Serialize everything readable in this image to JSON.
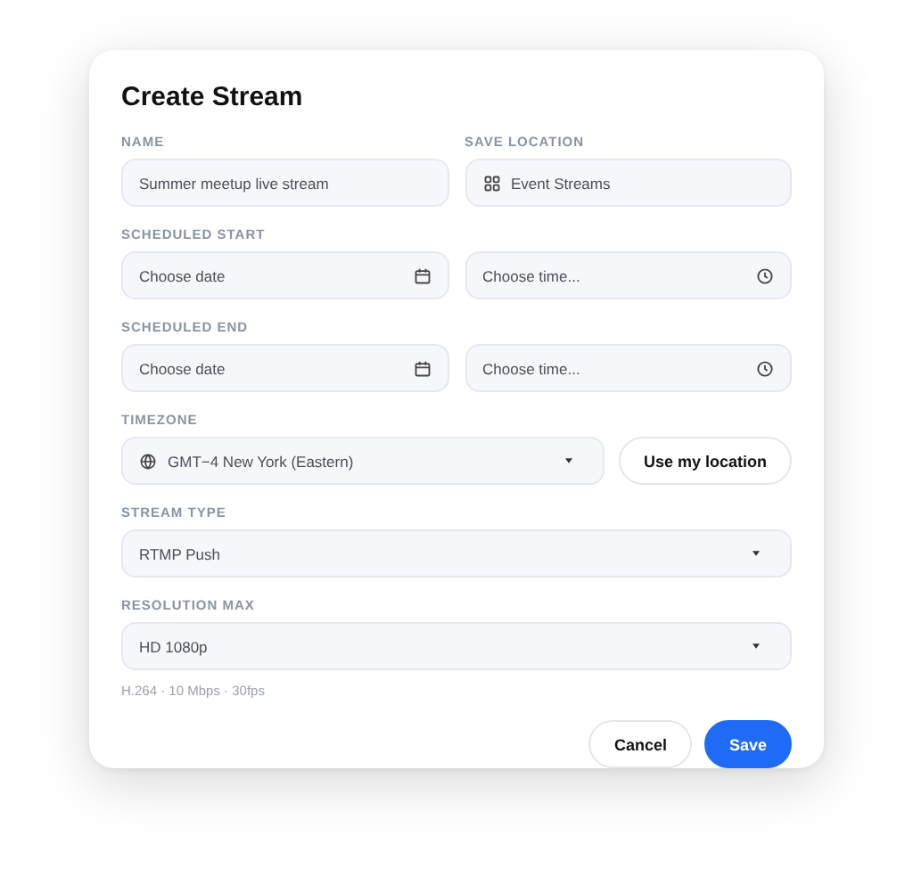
{
  "dialog": {
    "title": "Create Stream",
    "rows": [
      {
        "fields": [
          {
            "label": "NAME",
            "kind": "text",
            "value": "Summer meetup live stream"
          },
          {
            "label": "SAVE LOCATION",
            "kind": "location",
            "value": "Event Streams"
          }
        ]
      },
      {
        "label": "SCHEDULED START",
        "fields": [
          {
            "kind": "date",
            "placeholder": "Choose date"
          },
          {
            "kind": "time",
            "placeholder": "Choose time..."
          }
        ]
      },
      {
        "label": "SCHEDULED END",
        "fields": [
          {
            "kind": "date",
            "placeholder": "Choose date"
          },
          {
            "kind": "time",
            "placeholder": "Choose time..."
          }
        ]
      },
      {
        "label": "TIMEZONE",
        "fields": [
          {
            "kind": "timezone",
            "value": "GMT−4 New York (Eastern)"
          },
          {
            "kind": "button",
            "value": "Use my location"
          }
        ]
      },
      {
        "label": "STREAM TYPE",
        "fields": [
          {
            "kind": "select",
            "value": "RTMP Push"
          }
        ]
      },
      {
        "label": "RESOLUTION MAX",
        "fields": [
          {
            "kind": "select",
            "value": "HD 1080p"
          }
        ],
        "hint": "H.264 · 10 Mbps · 30fps"
      }
    ],
    "buttons": [
      {
        "label": "Cancel",
        "kind": "secondary"
      },
      {
        "label": "Save",
        "kind": "primary"
      }
    ]
  }
}
